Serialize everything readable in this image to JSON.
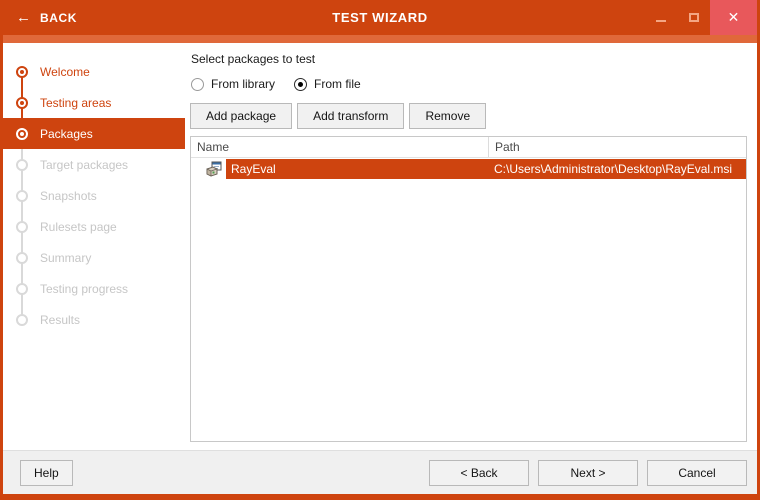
{
  "window": {
    "title": "TEST WIZARD",
    "back_label": "BACK",
    "icons": {
      "back": "←",
      "minimize": "minimize-bar",
      "maximize": "restore-square",
      "close": "✕"
    }
  },
  "sidebar": {
    "steps": [
      {
        "label": "Welcome",
        "state": "completed"
      },
      {
        "label": "Testing areas",
        "state": "completed"
      },
      {
        "label": "Packages",
        "state": "active"
      },
      {
        "label": "Target packages",
        "state": "pending"
      },
      {
        "label": "Snapshots",
        "state": "pending"
      },
      {
        "label": "Rulesets page",
        "state": "pending"
      },
      {
        "label": "Summary",
        "state": "pending"
      },
      {
        "label": "Testing progress",
        "state": "pending"
      },
      {
        "label": "Results",
        "state": "pending"
      }
    ]
  },
  "main": {
    "heading": "Select packages to test",
    "radios": [
      {
        "label": "From library",
        "selected": false
      },
      {
        "label": "From file",
        "selected": true
      }
    ],
    "toolbar": {
      "add_package": "Add package",
      "add_transform": "Add transform",
      "remove": "Remove"
    },
    "table": {
      "columns": {
        "name": "Name",
        "path": "Path"
      },
      "rows": [
        {
          "name": "RayEval",
          "path": "C:\\Users\\Administrator\\Desktop\\RayEval.msi",
          "icon": "msi-package-icon",
          "selected": true
        }
      ]
    }
  },
  "footer": {
    "help": "Help",
    "back": "< Back",
    "next": "Next >",
    "cancel": "Cancel"
  },
  "colors": {
    "accent_orange": "#CE440F",
    "strip_orange": "#E0683A",
    "close_button": "#E8585B",
    "pending_gray": "#C6C6C6",
    "footer_bg": "#F0F0F0"
  }
}
